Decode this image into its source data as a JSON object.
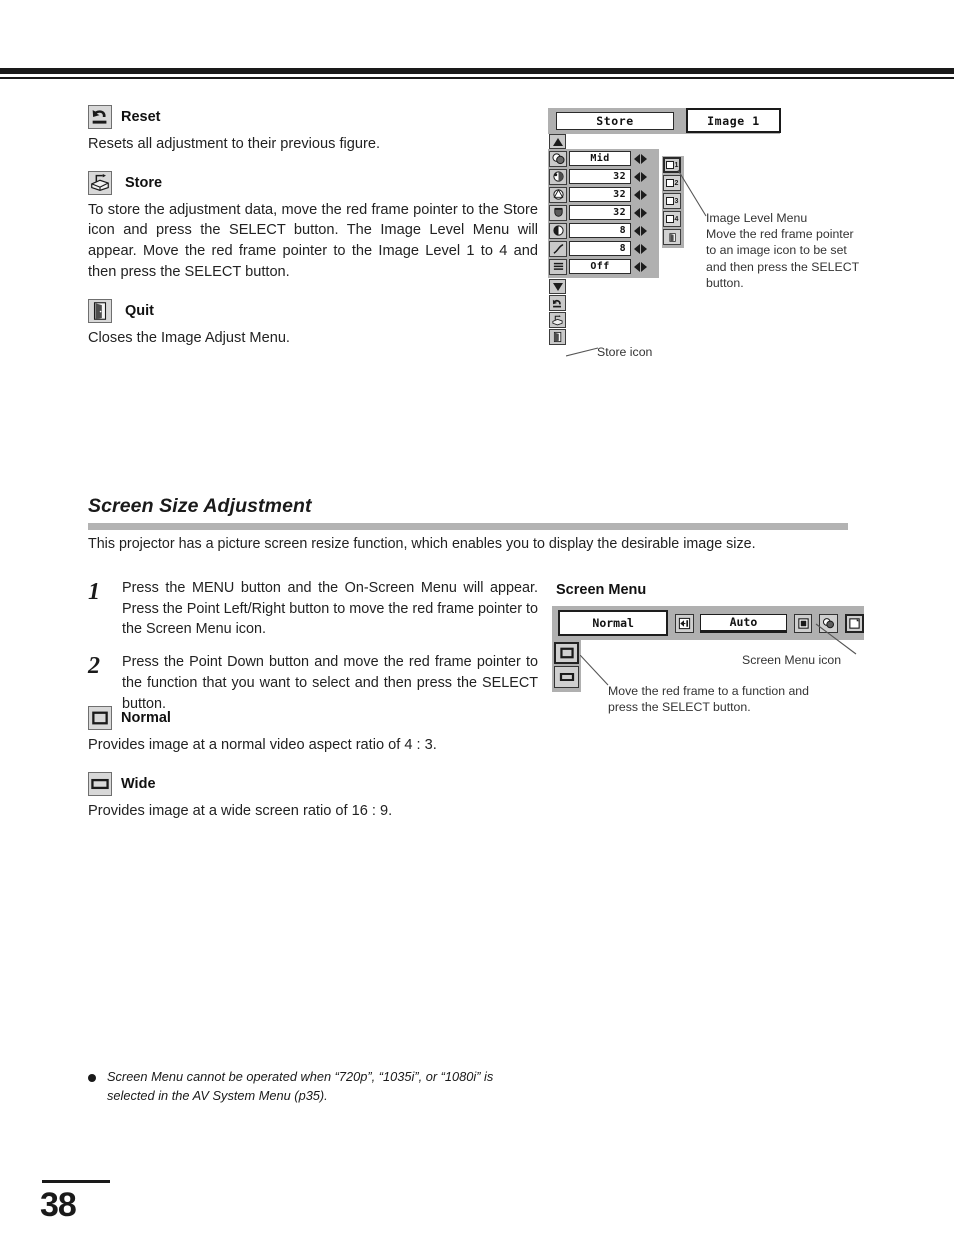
{
  "page": {
    "number": "38"
  },
  "adjust_items": [
    {
      "id": "reset",
      "icon": "reset-arrow-icon",
      "title": "Reset",
      "desc": "Resets all adjustment to their previous figure."
    },
    {
      "id": "store",
      "icon": "store-disk-icon",
      "title": "Store",
      "desc": "To store the adjustment data, move the red frame pointer to the Store icon and press the SELECT button.  The Image Level Menu will appear.  Move the red frame pointer to the Image Level 1 to 4 and then press the SELECT button."
    },
    {
      "id": "quit",
      "icon": "quit-door-icon",
      "title": "Quit",
      "desc": "Closes the Image Adjust Menu."
    }
  ],
  "image_adjust_osd": {
    "store_tab": "Store",
    "image_tab": "Image 1",
    "rows": [
      {
        "icon": "contrast-person-icon",
        "value": "Mid",
        "align": "center"
      },
      {
        "icon": "color-balance-icon",
        "value": "32",
        "align": "right"
      },
      {
        "icon": "tint-icon",
        "value": "32",
        "align": "right"
      },
      {
        "icon": "color-temp-icon",
        "value": "32",
        "align": "right"
      },
      {
        "icon": "contrast-circle-icon",
        "value": "8",
        "align": "right"
      },
      {
        "icon": "gamma-curve-icon",
        "value": "8",
        "align": "right"
      },
      {
        "icon": "progressive-lines-icon",
        "value": "Off",
        "align": "center"
      }
    ],
    "foot_icons": [
      "reset-arrow-icon",
      "store-disk-icon",
      "quit-door-icon"
    ],
    "level_icons": [
      {
        "label": "1",
        "selected": true
      },
      {
        "label": "2",
        "selected": false
      },
      {
        "label": "3",
        "selected": false
      },
      {
        "label": "4",
        "selected": false
      }
    ],
    "level_quit_icon": "quit-door-icon",
    "callout_image_level": "Image Level Menu\nMove the red frame pointer to an image icon to be set and then press the SELECT button.",
    "callout_store_icon": "Store icon"
  },
  "screen_section": {
    "heading": "Screen Size Adjustment",
    "intro": "This projector has a picture screen resize function, which enables you to display the desirable image size.",
    "steps": [
      {
        "num": "1",
        "text": "Press the MENU button and the On-Screen Menu will appear. Press the Point Left/Right button to move the red frame pointer to the Screen Menu icon."
      },
      {
        "num": "2",
        "text": "Press the Point Down button and move the red frame pointer to the function that you want to select and then press the SELECT button."
      }
    ],
    "options": [
      {
        "id": "normal",
        "icon": "normal-screen-icon",
        "title": "Normal",
        "desc": "Provides image at a normal video aspect ratio of 4 : 3."
      },
      {
        "id": "wide",
        "icon": "wide-screen-icon",
        "title": "Wide",
        "desc": "Provides image at a wide screen ratio of 16 : 9."
      }
    ],
    "note": "Screen Menu cannot be operated when “720p”, “1035i”, or “1080i” is selected in the AV System Menu (p35)."
  },
  "screen_osd": {
    "caption": "Screen Menu",
    "normal_label": "Normal",
    "auto_label": "Auto",
    "bar_icons": [
      "input-arrow-icon",
      "aspect-square-icon",
      "image-adjust-icon",
      "screen-menu-icon"
    ],
    "sub_icons": [
      "normal-screen-icon",
      "wide-screen-icon"
    ],
    "callout_icon": "Screen Menu icon",
    "callout_function": "Move the red frame to a function and press the SELECT button."
  },
  "colors": {
    "osd_gray": "#b0b0b0",
    "icon_gray": "#cfcfcf",
    "heading_bar": "#b3b3b3",
    "rule": "#1a1a1a"
  }
}
